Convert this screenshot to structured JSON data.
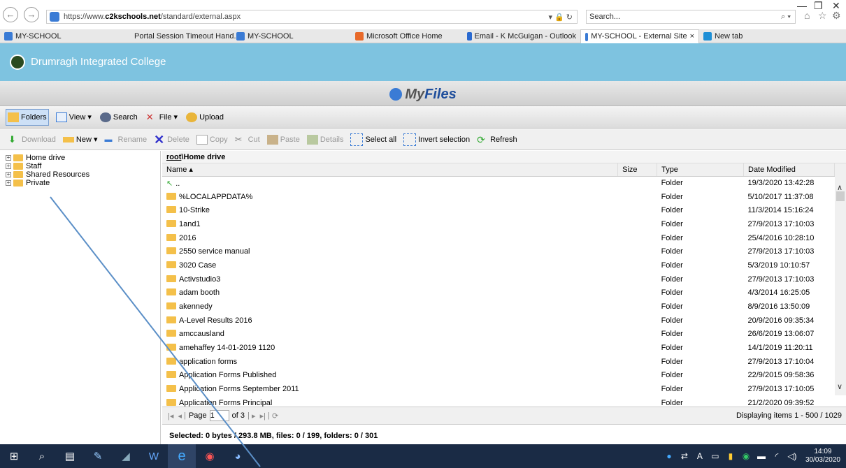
{
  "browser": {
    "url_prefix": "https://www.",
    "url_domain": "c2kschools.net",
    "url_path": "/standard/external.aspx",
    "address_controls": "▾ 🔒 ↻",
    "search_placeholder": "Search...",
    "tabs": [
      {
        "label": "MY-SCHOOL",
        "color": "#3a7bd5"
      },
      {
        "label": "Portal Session Timeout Hand...",
        "color": "#cc2222"
      },
      {
        "label": "MY-SCHOOL",
        "color": "#3a7bd5"
      },
      {
        "label": "Microsoft Office Home",
        "color": "#e86a2a"
      },
      {
        "label": "Email - K McGuigan - Outlook",
        "color": "#2a6ad0"
      },
      {
        "label": "MY-SCHOOL - External Site",
        "color": "#3a7bd5",
        "active": true
      },
      {
        "label": "New tab",
        "color": "#1e8fd6"
      }
    ]
  },
  "header": {
    "school_name": "Drumragh Integrated College"
  },
  "app": {
    "title_my": "My",
    "title_files": "Files"
  },
  "toolbar1": {
    "folders": "Folders",
    "view": "View ▾",
    "search": "Search",
    "file": "File ▾",
    "upload": "Upload"
  },
  "toolbar2": {
    "download": "Download",
    "new": "New ▾",
    "rename": "Rename",
    "delete": "Delete",
    "copy": "Copy",
    "cut": "Cut",
    "paste": "Paste",
    "details": "Details",
    "select_all": "Select all",
    "invert": "Invert selection",
    "refresh": "Refresh"
  },
  "tree": [
    "Home drive",
    "Staff",
    "Shared Resources",
    "Private"
  ],
  "breadcrumb": {
    "root": "root",
    "rest": "\\Home drive"
  },
  "columns": {
    "name": "Name ▴",
    "size": "Size",
    "type": "Type",
    "date": "Date Modified"
  },
  "rows": [
    {
      "name": "..",
      "type": "Folder",
      "date": "19/3/2020 13:42:28",
      "up": true
    },
    {
      "name": "%LOCALAPPDATA%",
      "type": "Folder",
      "date": "5/10/2017 11:37:08"
    },
    {
      "name": "10-Strike",
      "type": "Folder",
      "date": "11/3/2014 15:16:24"
    },
    {
      "name": "1and1",
      "type": "Folder",
      "date": "27/9/2013 17:10:03"
    },
    {
      "name": "2016",
      "type": "Folder",
      "date": "25/4/2016 10:28:10"
    },
    {
      "name": "2550 service manual",
      "type": "Folder",
      "date": "27/9/2013 17:10:03"
    },
    {
      "name": "3020 Case",
      "type": "Folder",
      "date": "5/3/2019 10:10:57"
    },
    {
      "name": "Activstudio3",
      "type": "Folder",
      "date": "27/9/2013 17:10:03"
    },
    {
      "name": "adam booth",
      "type": "Folder",
      "date": "4/3/2014 16:25:05"
    },
    {
      "name": "akennedy",
      "type": "Folder",
      "date": "8/9/2016 13:50:09"
    },
    {
      "name": "A-Level Results 2016",
      "type": "Folder",
      "date": "20/9/2016 09:35:34"
    },
    {
      "name": "amccausland",
      "type": "Folder",
      "date": "26/6/2019 13:06:07"
    },
    {
      "name": "amehaffey 14-01-2019 1120",
      "type": "Folder",
      "date": "14/1/2019 11:20:11"
    },
    {
      "name": "application forms",
      "type": "Folder",
      "date": "27/9/2013 17:10:04"
    },
    {
      "name": "Application Forms Published",
      "type": "Folder",
      "date": "22/9/2015 09:58:36"
    },
    {
      "name": "Application Forms September 2011",
      "type": "Folder",
      "date": "27/9/2013 17:10:05"
    },
    {
      "name": "Application Forms Principal",
      "type": "Folder",
      "date": "21/2/2020 09:39:52"
    }
  ],
  "pager": {
    "page_label": "Page",
    "page_value": "1",
    "of_label": "of 3",
    "display": "Displaying items 1 - 500 / 1029"
  },
  "status": {
    "text": "Selected: 0 bytes / 293.8 MB, files: 0 / 199, folders: 0 / 301"
  },
  "taskbar": {
    "time": "14:09",
    "date": "30/03/2020"
  }
}
